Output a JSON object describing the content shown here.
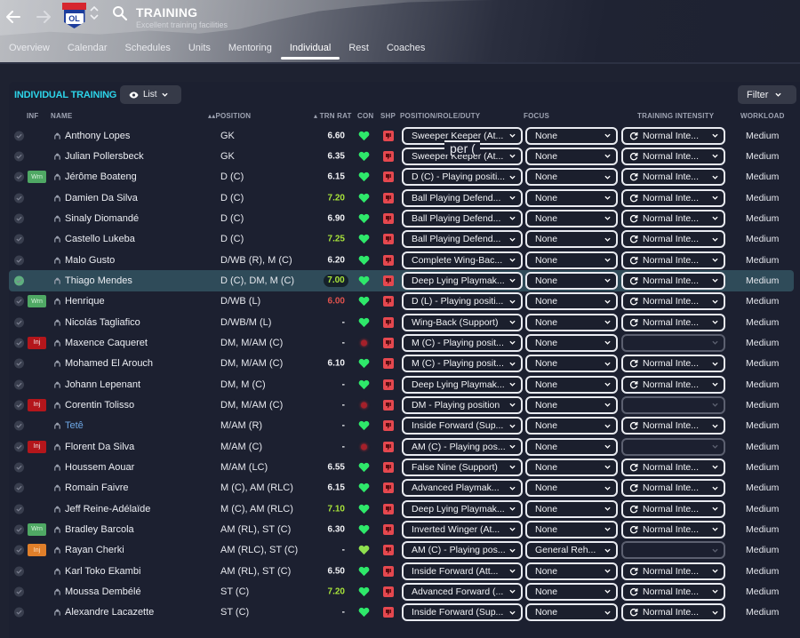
{
  "header": {
    "title": "TRAINING",
    "subtitle": "Excellent training facilities",
    "club_logo_text": "OL"
  },
  "tabs": [
    {
      "label": "Overview",
      "active": false
    },
    {
      "label": "Calendar",
      "active": false
    },
    {
      "label": "Schedules",
      "active": false
    },
    {
      "label": "Units",
      "active": false
    },
    {
      "label": "Mentoring",
      "active": false
    },
    {
      "label": "Individual",
      "active": true
    },
    {
      "label": "Rest",
      "active": false
    },
    {
      "label": "Coaches",
      "active": false
    }
  ],
  "section": {
    "title": "INDIVIDUAL TRAINING",
    "view_label": "List",
    "filter_label": "Filter"
  },
  "columns": {
    "inf": "INF",
    "name": "NAME",
    "position": "POSITION",
    "trn_rat": "TRN RAT",
    "con": "CON",
    "shp": "SHP",
    "role": "POSITION/ROLE/DUTY",
    "focus": "FOCUS",
    "intensity": "TRAINING INTENSITY",
    "workload": "WORKLOAD"
  },
  "colors": {
    "accent": "#2dd3e8",
    "good_rating": "#a8e43a",
    "bad_rating": "#e0524d",
    "condition_good": "#2ee86a",
    "sharpness": "#e5484f",
    "injury": "#b4161b",
    "warning": "#4fa864"
  },
  "players": [
    {
      "name": "Anthony Lopes",
      "inf": "",
      "position": "GK",
      "trn_rat": "6.60",
      "rat_style": "",
      "con": "heart",
      "role": "Sweeper Keeper (At...",
      "focus": "None",
      "intensity": "Normal Inte...",
      "workload": "Medium"
    },
    {
      "name": "Julian Pollersbeck",
      "inf": "",
      "position": "GK",
      "trn_rat": "6.35",
      "rat_style": "",
      "con": "heart",
      "role": "Sweeper Keeper (At...",
      "focus": "None",
      "intensity": "Normal Inte...",
      "workload": "Medium"
    },
    {
      "name": "Jérôme Boateng",
      "inf": "Wrn",
      "position": "D (C)",
      "trn_rat": "6.15",
      "rat_style": "",
      "con": "heart",
      "role": "D (C) - Playing positi...",
      "focus": "None",
      "intensity": "Normal Inte...",
      "workload": "Medium"
    },
    {
      "name": "Damien Da Silva",
      "inf": "",
      "position": "D (C)",
      "trn_rat": "7.20",
      "rat_style": "good",
      "con": "heart",
      "role": "Ball Playing Defend...",
      "focus": "None",
      "intensity": "Normal Inte...",
      "workload": "Medium"
    },
    {
      "name": "Sinaly Diomandé",
      "inf": "",
      "position": "D (C)",
      "trn_rat": "6.90",
      "rat_style": "",
      "con": "heart",
      "role": "Ball Playing Defend...",
      "focus": "None",
      "intensity": "Normal Inte...",
      "workload": "Medium"
    },
    {
      "name": "Castello Lukeba",
      "inf": "",
      "position": "D (C)",
      "trn_rat": "7.25",
      "rat_style": "good",
      "con": "heart",
      "role": "Ball Playing Defend...",
      "focus": "None",
      "intensity": "Normal Inte...",
      "workload": "Medium"
    },
    {
      "name": "Malo Gusto",
      "inf": "",
      "position": "D/WB (R), M (C)",
      "trn_rat": "6.20",
      "rat_style": "",
      "con": "heart",
      "role": "Complete Wing-Bac...",
      "focus": "None",
      "intensity": "Normal Inte...",
      "workload": "Medium"
    },
    {
      "name": "Thiago Mendes",
      "inf": "",
      "position": "D (C), DM, M (C)",
      "trn_rat": "7.00",
      "rat_style": "good pill",
      "con": "heart",
      "role": "Deep Lying Playmak...",
      "focus": "None",
      "intensity": "Normal Inte...",
      "workload": "Medium",
      "selected": true
    },
    {
      "name": "Henrique",
      "inf": "Wrn",
      "position": "D/WB (L)",
      "trn_rat": "6.00",
      "rat_style": "bad",
      "con": "heart",
      "role": "D (L) - Playing positi...",
      "focus": "None",
      "intensity": "Normal Inte...",
      "workload": "Medium"
    },
    {
      "name": "Nicolás Tagliafico",
      "inf": "",
      "position": "D/WB/M (L)",
      "trn_rat": "-",
      "rat_style": "",
      "con": "heart",
      "role": "Wing-Back (Support)",
      "focus": "None",
      "intensity": "Normal Inte...",
      "workload": "Medium"
    },
    {
      "name": "Maxence Caqueret",
      "inf": "Inj",
      "position": "DM, M/AM (C)",
      "trn_rat": "-",
      "rat_style": "",
      "con": "injured",
      "role": "M (C) - Playing posit...",
      "focus": "None",
      "intensity": "",
      "workload": "Medium"
    },
    {
      "name": "Mohamed El Arouch",
      "inf": "",
      "position": "DM, M/AM (C)",
      "trn_rat": "6.10",
      "rat_style": "",
      "con": "heart",
      "role": "M (C) - Playing posit...",
      "focus": "None",
      "intensity": "Normal Inte...",
      "workload": "Medium"
    },
    {
      "name": "Johann Lepenant",
      "inf": "",
      "position": "DM, M (C)",
      "trn_rat": "-",
      "rat_style": "",
      "con": "heart",
      "role": "Deep Lying Playmak...",
      "focus": "None",
      "intensity": "Normal Inte...",
      "workload": "Medium"
    },
    {
      "name": "Corentin Tolisso",
      "inf": "Inj",
      "position": "DM, M/AM (C)",
      "trn_rat": "-",
      "rat_style": "",
      "con": "injured",
      "role": "DM - Playing position",
      "focus": "None",
      "intensity": "",
      "workload": "Medium"
    },
    {
      "name": "Tetê",
      "inf": "",
      "position": "M/AM (R)",
      "trn_rat": "-",
      "rat_style": "",
      "con": "heart",
      "role": "Inside Forward (Sup...",
      "focus": "None",
      "intensity": "Normal Inte...",
      "workload": "Medium",
      "link": true
    },
    {
      "name": "Florent Da Silva",
      "inf": "Inj",
      "position": "M/AM (C)",
      "trn_rat": "-",
      "rat_style": "",
      "con": "injured",
      "role": "AM (C) - Playing pos...",
      "focus": "None",
      "intensity": "",
      "workload": "Medium"
    },
    {
      "name": "Houssem Aouar",
      "inf": "",
      "position": "M/AM (LC)",
      "trn_rat": "6.55",
      "rat_style": "",
      "con": "heart",
      "role": "False Nine (Support)",
      "focus": "None",
      "intensity": "Normal Inte...",
      "workload": "Medium"
    },
    {
      "name": "Romain Faivre",
      "inf": "",
      "position": "M (C), AM (RLC)",
      "trn_rat": "6.15",
      "rat_style": "",
      "con": "heart",
      "role": "Advanced Playmak...",
      "focus": "None",
      "intensity": "Normal Inte...",
      "workload": "Medium"
    },
    {
      "name": "Jeff Reine-Adélaïde",
      "inf": "",
      "position": "M (C), AM (RLC)",
      "trn_rat": "7.10",
      "rat_style": "good",
      "con": "heart",
      "role": "Deep Lying Playmak...",
      "focus": "None",
      "intensity": "Normal Inte...",
      "workload": "Medium"
    },
    {
      "name": "Bradley Barcola",
      "inf": "Wrn",
      "position": "AM (RL), ST (C)",
      "trn_rat": "6.30",
      "rat_style": "",
      "con": "heart",
      "role": "Inverted Winger (At...",
      "focus": "None",
      "intensity": "Normal Inte...",
      "workload": "Medium"
    },
    {
      "name": "Rayan Cherki",
      "inf": "Inj",
      "inf_style": "injlight",
      "position": "AM (RLC), ST (C)",
      "trn_rat": "-",
      "rat_style": "",
      "con": "heart-light",
      "role": "AM (C) - Playing pos...",
      "focus": "General Reh...",
      "intensity": "",
      "workload": "Medium"
    },
    {
      "name": "Karl Toko Ekambi",
      "inf": "",
      "position": "AM (RL), ST (C)",
      "trn_rat": "6.50",
      "rat_style": "",
      "con": "heart",
      "role": "Inside Forward (Att...",
      "focus": "None",
      "intensity": "Normal Inte...",
      "workload": "Medium"
    },
    {
      "name": "Moussa Dembélé",
      "inf": "",
      "position": "ST (C)",
      "trn_rat": "7.20",
      "rat_style": "good",
      "con": "heart",
      "role": "Advanced Forward (...",
      "focus": "None",
      "intensity": "Normal Inte...",
      "workload": "Medium"
    },
    {
      "name": "Alexandre Lacazette",
      "inf": "",
      "position": "ST (C)",
      "trn_rat": "-",
      "rat_style": "",
      "con": "heart",
      "role": "Inside Forward (Sup...",
      "focus": "None",
      "intensity": "Normal Inte...",
      "workload": "Medium"
    }
  ],
  "overlay_glitch_text": "per ("
}
